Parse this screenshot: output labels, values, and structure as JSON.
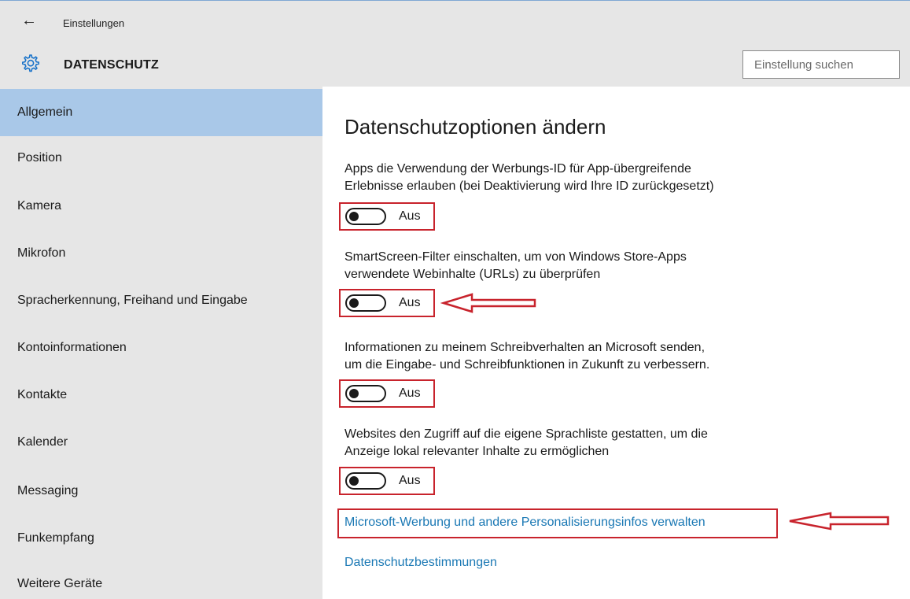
{
  "window": {
    "app_title": "Einstellungen",
    "back_icon": "back-arrow-icon"
  },
  "header": {
    "icon": "gear-icon",
    "title": "DATENSCHUTZ",
    "search_placeholder": "Einstellung suchen"
  },
  "sidebar": {
    "items": [
      {
        "label": "Allgemein",
        "active": true
      },
      {
        "label": "Position"
      },
      {
        "label": "Kamera"
      },
      {
        "label": "Mikrofon"
      },
      {
        "label": "Spracherkennung, Freihand und Eingabe"
      },
      {
        "label": "Kontoinformationen"
      },
      {
        "label": "Kontakte"
      },
      {
        "label": "Kalender"
      },
      {
        "label": "Messaging"
      },
      {
        "label": "Funkempfang"
      },
      {
        "label": "Weitere Geräte"
      }
    ]
  },
  "main": {
    "heading": "Datenschutzoptionen ändern",
    "settings": [
      {
        "line1": "Apps die Verwendung der Werbungs-ID für App-übergreifende",
        "line2": "Erlebnisse erlauben (bei Deaktivierung wird Ihre ID zurückgesetzt)",
        "state": "Aus"
      },
      {
        "line1": "SmartScreen-Filter einschalten, um von Windows Store-Apps",
        "line2": "verwendete Webinhalte (URLs) zu überprüfen",
        "state": "Aus"
      },
      {
        "line1": "Informationen zu meinem Schreibverhalten an Microsoft senden,",
        "line2": "um die Eingabe- und Schreibfunktionen in Zukunft zu verbessern.",
        "state": "Aus"
      },
      {
        "line1": "Websites den Zugriff auf die eigene Sprachliste gestatten, um die",
        "line2": "Anzeige lokal relevanter Inhalte zu ermöglichen",
        "state": "Aus"
      }
    ],
    "links": {
      "personalization": "Microsoft-Werbung und andere Personalisierungsinfos verwalten",
      "privacy_statement": "Datenschutzbestimmungen"
    }
  },
  "colors": {
    "chrome_bg": "#e6e6e6",
    "active_item": "#a9c8e8",
    "link": "#1a78b4",
    "annotation_red": "#c8232c"
  }
}
